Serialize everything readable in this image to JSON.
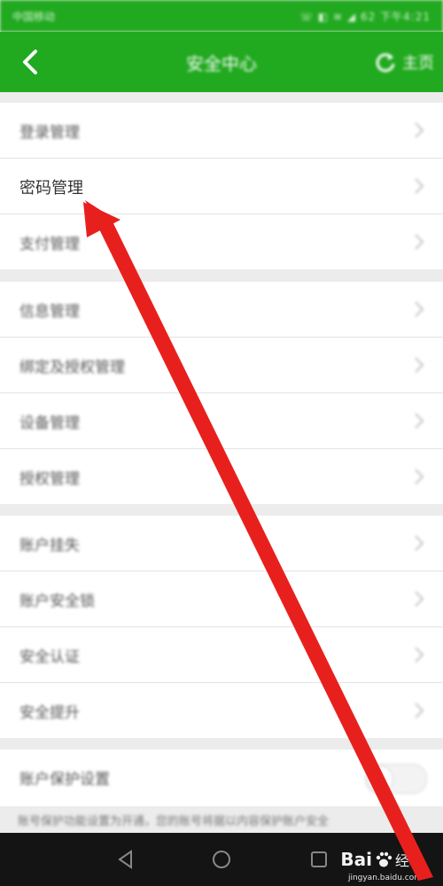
{
  "status_bar": {
    "carrier": "中国移动",
    "right_info": "☏ ◧ ≋ ◢ 62  下午4:21"
  },
  "header": {
    "title": "安全中心",
    "home_label": "主页"
  },
  "sections": [
    {
      "items": [
        "登录管理",
        "密码管理",
        "支付管理"
      ]
    },
    {
      "items": [
        "信息管理",
        "绑定及授权管理",
        "设备管理",
        "授权管理"
      ]
    },
    {
      "items": [
        "账户挂失",
        "账户安全锁",
        "安全认证",
        "安全提升"
      ]
    }
  ],
  "toggle_row": {
    "label": "账户保护设置",
    "note": "账号保护功能设置为开通，您的账号将据以内容保护账户安全"
  },
  "watermark": {
    "text_a": "Bai",
    "text_b": "经验",
    "sub": "jingyan.baidu.com"
  },
  "colors": {
    "brand_green": "#21a91f",
    "arrow_red": "#e8201d"
  }
}
